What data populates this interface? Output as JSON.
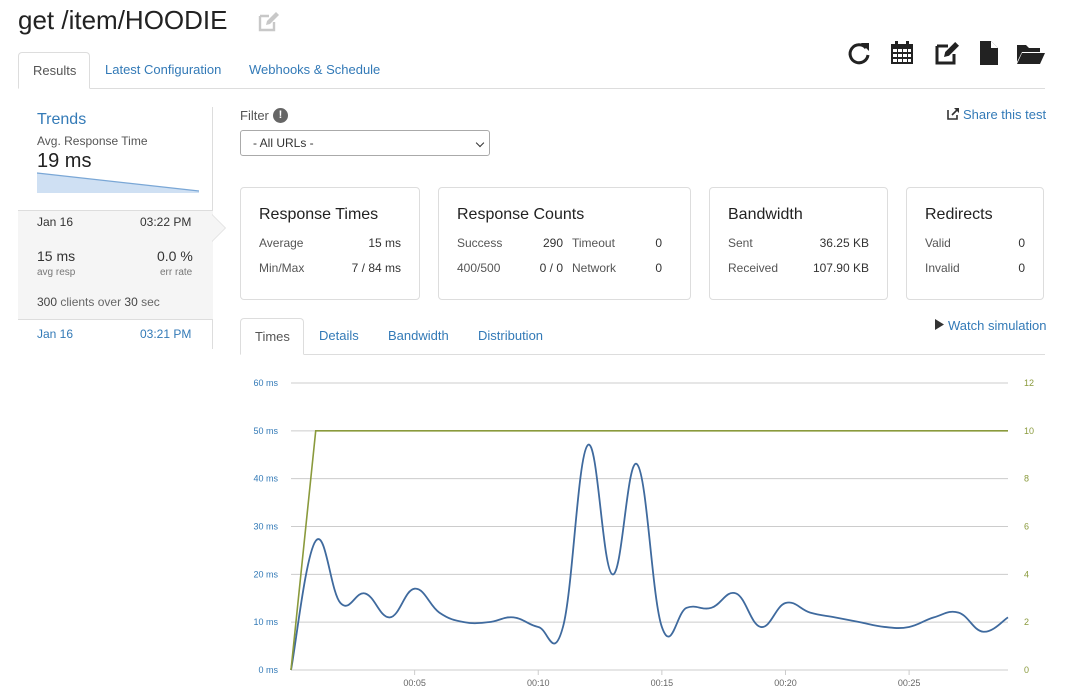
{
  "header": {
    "title": "get /item/HOODIE"
  },
  "toolbar": {
    "icons": [
      "refresh-icon",
      "calendar-icon",
      "edit-icon",
      "file-icon",
      "folder-open-icon"
    ]
  },
  "main_tabs": [
    {
      "label": "Results",
      "active": true
    },
    {
      "label": "Latest Configuration",
      "active": false
    },
    {
      "label": "Webhooks & Schedule",
      "active": false
    }
  ],
  "trends": {
    "title": "Trends",
    "subtitle": "Avg. Response Time",
    "value": "19 ms"
  },
  "runs": {
    "active": {
      "date": "Jan 16",
      "time": "03:22 PM",
      "avg_resp_value": "15 ms",
      "avg_resp_label": "avg resp",
      "err_rate_value": "0.0 %",
      "err_rate_label": "err rate",
      "clients": "300",
      "clients_text": "clients over",
      "duration": "30",
      "duration_unit": "sec"
    },
    "previous": {
      "date": "Jan 16",
      "time": "03:21 PM"
    }
  },
  "filter": {
    "label": "Filter",
    "info": "!",
    "selected": "- All URLs -"
  },
  "share": {
    "label": "Share this test"
  },
  "cards": {
    "response_times": {
      "title": "Response Times",
      "average_label": "Average",
      "average_value": "15 ms",
      "minmax_label": "Min/Max",
      "minmax_value": "7 / 84 ms"
    },
    "response_counts": {
      "title": "Response Counts",
      "success_label": "Success",
      "success_value": "290",
      "timeout_label": "Timeout",
      "timeout_value": "0",
      "err_label": "400/500",
      "err_value": "0 / 0",
      "network_label": "Network",
      "network_value": "0"
    },
    "bandwidth": {
      "title": "Bandwidth",
      "sent_label": "Sent",
      "sent_value": "36.25 KB",
      "received_label": "Received",
      "received_value": "107.90 KB"
    },
    "redirects": {
      "title": "Redirects",
      "valid_label": "Valid",
      "valid_value": "0",
      "invalid_label": "Invalid",
      "invalid_value": "0"
    }
  },
  "chart_tabs": [
    {
      "label": "Times",
      "active": true
    },
    {
      "label": "Details",
      "active": false
    },
    {
      "label": "Bandwidth",
      "active": false
    },
    {
      "label": "Distribution",
      "active": false
    }
  ],
  "watch": {
    "label": "Watch simulation"
  },
  "colors": {
    "link": "#337ab7",
    "response_line": "#3f6a9e",
    "clients_line": "#8a9a3c",
    "left_axis_text": "#337ab7",
    "right_axis_text": "#8a9a3c"
  },
  "chart_data": {
    "type": "line",
    "x": [
      "00:00",
      "00:01",
      "00:02",
      "00:03",
      "00:04",
      "00:05",
      "00:06",
      "00:07",
      "00:08",
      "00:09",
      "00:10",
      "00:11",
      "00:12",
      "00:13",
      "00:14",
      "00:15",
      "00:16",
      "00:17",
      "00:18",
      "00:19",
      "00:20",
      "00:21",
      "00:22",
      "00:23",
      "00:24",
      "00:25",
      "00:26",
      "00:27",
      "00:28",
      "00:29"
    ],
    "x_tick_labels": [
      "00:05",
      "00:10",
      "00:15",
      "00:20",
      "00:25"
    ],
    "y_left_ticks": [
      "0 ms",
      "10 ms",
      "20 ms",
      "30 ms",
      "40 ms",
      "50 ms",
      "60 ms"
    ],
    "y_right_ticks": [
      "0",
      "2",
      "4",
      "6",
      "8",
      "10",
      "12"
    ],
    "ylim_left": [
      0,
      60
    ],
    "ylim_right": [
      0,
      12
    ],
    "grid": true,
    "series": [
      {
        "axis": "left",
        "color": "#3f6a9e",
        "values": [
          0,
          27,
          14,
          16,
          11,
          17,
          12,
          10,
          10,
          11,
          9,
          9,
          47,
          20,
          43,
          9,
          13,
          13,
          16,
          9,
          14,
          12,
          11,
          10,
          9,
          9,
          11,
          12,
          8,
          11
        ]
      },
      {
        "axis": "right",
        "color": "#8a9a3c",
        "values": [
          0,
          10,
          10,
          10,
          10,
          10,
          10,
          10,
          10,
          10,
          10,
          10,
          10,
          10,
          10,
          10,
          10,
          10,
          10,
          10,
          10,
          10,
          10,
          10,
          10,
          10,
          10,
          10,
          10,
          10
        ]
      }
    ]
  }
}
